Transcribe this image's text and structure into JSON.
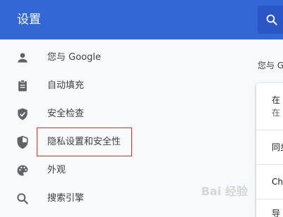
{
  "header": {
    "title": "设置",
    "search_icon": "search-icon"
  },
  "sidebar": {
    "items": [
      {
        "label": "您与 Google",
        "icon": "person-icon"
      },
      {
        "label": "自动填充",
        "icon": "clipboard-icon"
      },
      {
        "label": "安全检查",
        "icon": "shield-check-icon"
      },
      {
        "label": "隐私设置和安全性",
        "icon": "shield-half-icon"
      },
      {
        "label": "外观",
        "icon": "palette-icon"
      },
      {
        "label": "搜索引擎",
        "icon": "search-icon"
      }
    ]
  },
  "main": {
    "heading": "您与 G",
    "card_rows": [
      {
        "line1": "在",
        "line2": "在"
      },
      {
        "line1": "同步"
      },
      {
        "line1": "Ch"
      },
      {
        "line1": "导"
      }
    ]
  },
  "watermark": "Bai 经验",
  "colors": {
    "header": "#3367d6",
    "highlight_border": "#d93025",
    "icon": "#5f6368"
  }
}
